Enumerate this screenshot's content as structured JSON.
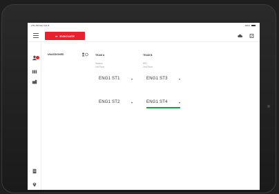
{
  "statusbar": {
    "left_text": "2:51 PM   Mon Feb 8",
    "right_text": "100%"
  },
  "header": {
    "evacuate_label": "EVACUATE",
    "evacuate_color": "#e8212e"
  },
  "icons": {
    "menu": "menu-icon",
    "cloud": "cloud-icon",
    "sync": "sync-icon",
    "people": "people-icon",
    "grid": "grid-icon",
    "truck": "truck-icon",
    "document": "document-icon",
    "location": "location-pin-icon"
  },
  "board": {
    "unassigned_header": "UNASSIGNED",
    "team_a_header": "TEAM A",
    "team_b_header": "TEAM B",
    "team_a_assignment": "Search",
    "team_a_location": "1st Floor",
    "team_b_assignment": "RIC",
    "team_b_location": "2nd Floor",
    "rows": [
      {
        "team_a_unit": "ENG1 ST1",
        "team_b_unit": "ENG1 ST3"
      },
      {
        "team_a_unit": "ENG1 ST2",
        "team_b_unit": "ENG1 ST4"
      }
    ],
    "selected_color": "#1a9e3c"
  }
}
